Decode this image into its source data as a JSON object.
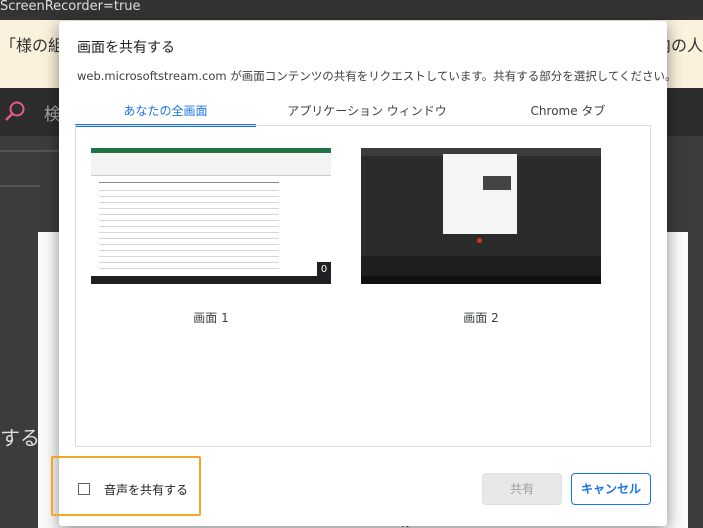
{
  "background": {
    "url_text": "ScreenRecorder=true",
    "banner_left": "「様の組織",
    "banner_right": "内の人",
    "search_text": "検",
    "side_text": "する"
  },
  "dialog": {
    "title": "画面を共有する",
    "message": "web.microsoftstream.com が画面コンテンツの共有をリクエストしています。共有する部分を選択してください。",
    "tabs": [
      {
        "label": "あなたの全画面",
        "active": true
      },
      {
        "label": "アプリケーション ウィンドウ",
        "active": false
      },
      {
        "label": "Chrome タブ",
        "active": false
      }
    ],
    "screens": [
      {
        "label": "画面 1",
        "badge": "0"
      },
      {
        "label": "画面 2"
      }
    ],
    "audio_checkbox": {
      "label": "音声を共有する",
      "checked": false
    },
    "buttons": {
      "share": "共有",
      "cancel": "キャンセル"
    }
  },
  "colors": {
    "accent": "#1a73e8",
    "highlight": "#f2a72a"
  }
}
